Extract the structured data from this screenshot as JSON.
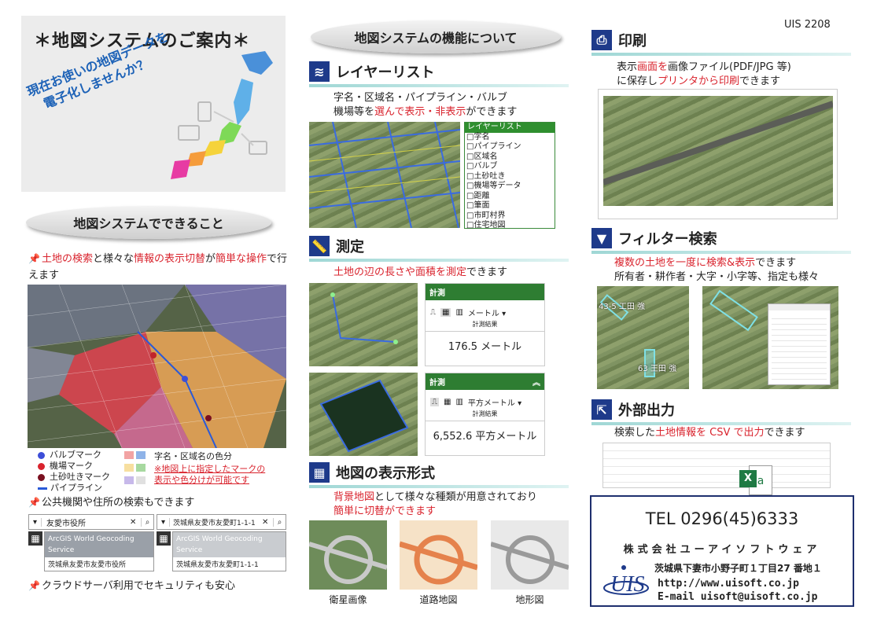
{
  "doc_id": "UIS 2208",
  "intro": {
    "title": "＊地図システムのご案内＊",
    "catch_line1": "現在お使いの地図データを",
    "catch_line2": "電子化しませんか？"
  },
  "left": {
    "section_title": "地図システムでできること",
    "bullet1_parts": [
      "土地の検索",
      "と様々な",
      "情報の表示切替",
      "が",
      "簡単な操作",
      "で行えます"
    ],
    "legend": {
      "valve": "バルブマーク",
      "station": "機場マーク",
      "outlet": "土砂吐きマーク",
      "pipeline": "パイプライン",
      "area_colors": "字名・区域名の色分",
      "note_line1": "※地図上に指定したマークの",
      "note_line2": "表示や色分けが可能です"
    },
    "bullet2": "公共機関や住所の検索もできます",
    "search1": {
      "input": "友愛市役所",
      "service_line1": "ArcGIS World Geocoding",
      "service_line2": "Service",
      "result": "茨城県友愛市友愛市役所"
    },
    "search2": {
      "input": "茨城県友愛市友愛町1-1-1",
      "service_line1": "ArcGIS World Geocoding",
      "service_line2": "Service",
      "result": "茨城県友愛市友愛町1-1-1"
    },
    "bullet3": "クラウドサーバ利用でセキュリティも安心"
  },
  "middle": {
    "section_title": "地図システムの機能について",
    "layer": {
      "title": "レイヤーリスト",
      "desc_line1": "字名・区域名・パイプライン・バルブ",
      "desc_line2_a": "機場等を",
      "desc_line2_red": "選んで表示・非表示",
      "desc_line2_b": "ができます",
      "panel_title": "レイヤーリスト",
      "items": [
        "□字名",
        "□パイプライン",
        "□区域名",
        "□バルブ",
        "□土砂吐き",
        "□機場等データ",
        "□距離",
        "□筆面",
        "□市町村界",
        "□住宅地図"
      ]
    },
    "measure": {
      "title": "測定",
      "desc_red": "土地の辺の長さや面積を測定",
      "desc_b": "できます",
      "panel1": {
        "head": "計測",
        "unit": "メートル ▾",
        "result_label": "計測結果",
        "value": "176.5 メートル"
      },
      "panel2": {
        "head": "計測",
        "unit": "平方メートル ▾",
        "result_label": "計測結果",
        "value": "6,552.6 平方メートル"
      }
    },
    "display": {
      "title": "地図の表示形式",
      "desc_line1_red": "背景地図",
      "desc_line1_b": "として様々な種類が用意されており",
      "desc_line2_red": "簡単に切替ができます",
      "maps": [
        "衛星画像",
        "道路地図",
        "地形図"
      ]
    }
  },
  "right": {
    "print": {
      "title": "印刷",
      "desc_line1_a": "表示",
      "desc_line1_red": "画面を",
      "desc_line1_b": "画像ファイル(PDF/JPG 等)",
      "desc_line2_a": "に保存し",
      "desc_line2_red": "プリンタから印刷",
      "desc_line2_b": "できます"
    },
    "filter": {
      "title": "フィルター検索",
      "desc_line1_red": "複数の土地を一度に検索&表示",
      "desc_line1_b": "できます",
      "desc_line2": "所有者・耕作者・大字・小字等、指定も様々",
      "label1": "43-5 工田 強",
      "label2": "63 王田 強"
    },
    "export": {
      "title": "外部出力",
      "desc_a": "検索した",
      "desc_red": "土地情報を CSV で出力",
      "desc_b": "できます"
    },
    "contact": {
      "tel": "TEL 0296(45)6333",
      "company": "株式会社ユーアイソフトウェア",
      "address": "茨城県下妻市小野子町１丁目27 番地１",
      "url": "http://www.uisoft.co.jp",
      "email": "E-mail uisoft@uisoft.co.jp",
      "logo": "UIS"
    }
  }
}
